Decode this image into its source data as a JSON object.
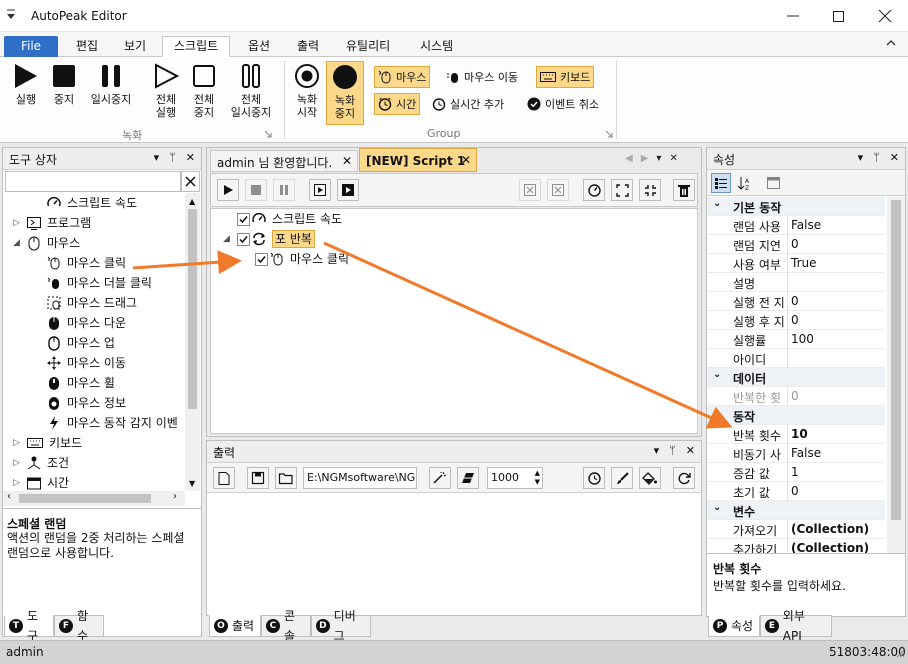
{
  "window": {
    "title": "AutoPeak Editor"
  },
  "menu": {
    "file": "File",
    "tabs": [
      "편집",
      "보기",
      "스크립트",
      "옵션",
      "출력",
      "유틸리티",
      "시스템"
    ]
  },
  "ribbon": {
    "run": "실행",
    "stop": "중지",
    "pause": "일시중지",
    "all_run": [
      "전체",
      "실행"
    ],
    "all_stop": [
      "전체",
      "중지"
    ],
    "all_pause": [
      "전체",
      "일시중지"
    ],
    "rec_start": [
      "녹화",
      "시작"
    ],
    "rec_stop": [
      "녹화",
      "중지"
    ],
    "group_record": "녹화",
    "group_group": "Group",
    "mouse": "마우스",
    "mouse_move": "마우스 이동",
    "keyboard": "키보드",
    "time": "시간",
    "realtime_add": "실시간 추가",
    "event_cancel": "이벤트 취소"
  },
  "toolbox": {
    "title": "도구 상자",
    "items": [
      "스크립트 속도",
      "프로그램",
      "마우스",
      "마우스 클릭",
      "마우스 더블 클릭",
      "마우스 드래그",
      "마우스 다운",
      "마우스 업",
      "마우스 이동",
      "마우스 휠",
      "마우스 정보",
      "마우스 동작 감지 이벤",
      "키보드",
      "조건",
      "시간"
    ],
    "desc_title": "스페셜 랜덤",
    "desc_text": "액션의 랜덤을 2중 처리하는 스페셜 랜덤으로 사용합니다.",
    "tab_tool": "도구",
    "tab_func": "함수"
  },
  "editor": {
    "tab1": "admin 님 환영합니다.",
    "tab2": "[NEW] Script 1",
    "nodes": [
      "스크립트 속도",
      "포 반복",
      "마우스 클릭"
    ]
  },
  "output": {
    "title": "출력",
    "path": "E:\\NGMsoftware\\NG",
    "count": "1000",
    "tabs": [
      "출력",
      "콘솔",
      "디버그"
    ]
  },
  "props": {
    "title": "속성",
    "rows": [
      {
        "cat": true,
        "k": "기본 동작"
      },
      {
        "k": "랜덤 사용",
        "v": "False"
      },
      {
        "k": "랜덤 지연",
        "v": "0"
      },
      {
        "k": "사용 여부",
        "v": "True"
      },
      {
        "k": "설명",
        "v": ""
      },
      {
        "k": "실행 전 지",
        "v": "0"
      },
      {
        "k": "실행 후 지",
        "v": "0"
      },
      {
        "k": "실행률",
        "v": "100"
      },
      {
        "k": "아이디",
        "v": ""
      },
      {
        "cat": true,
        "k": "데이터"
      },
      {
        "k": "반복한 횟",
        "v": "0",
        "dim": true
      },
      {
        "cat": true,
        "k": "동작"
      },
      {
        "k": "반복 횟수",
        "v": "10",
        "bold": true
      },
      {
        "k": "비동기 사",
        "v": "False"
      },
      {
        "k": "증감 값",
        "v": "1"
      },
      {
        "k": "초기 값",
        "v": "0"
      },
      {
        "cat": true,
        "k": "변수"
      },
      {
        "k": "가져오기",
        "v": "(Collection)",
        "bold": true
      },
      {
        "k": "추가하기",
        "v": "(Collection)",
        "bold": true
      }
    ],
    "desc_title": "반복 횟수",
    "desc_text": "반복할 횟수를 입력하세요.",
    "tab_prop": "속성",
    "tab_api": "외부 API"
  },
  "status": {
    "user": "admin",
    "time": "51803:48:00"
  },
  "colors": {
    "accent": "#2f6fc8",
    "highlight": "#fcd98a",
    "arrow": "#f07a2a"
  }
}
